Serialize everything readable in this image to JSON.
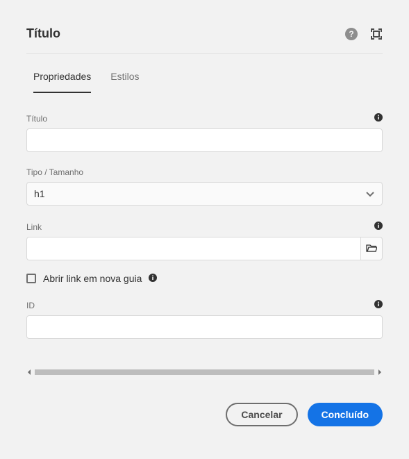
{
  "dialog": {
    "title": "Título"
  },
  "tabs": {
    "properties": "Propriedades",
    "styles": "Estilos"
  },
  "fields": {
    "title_label": "Título",
    "title_value": "",
    "type_label": "Tipo / Tamanho",
    "type_value": "h1",
    "link_label": "Link",
    "link_value": "",
    "newtab_label": "Abrir link em nova guia",
    "id_label": "ID",
    "id_value": ""
  },
  "footer": {
    "cancel": "Cancelar",
    "done": "Concluído"
  }
}
